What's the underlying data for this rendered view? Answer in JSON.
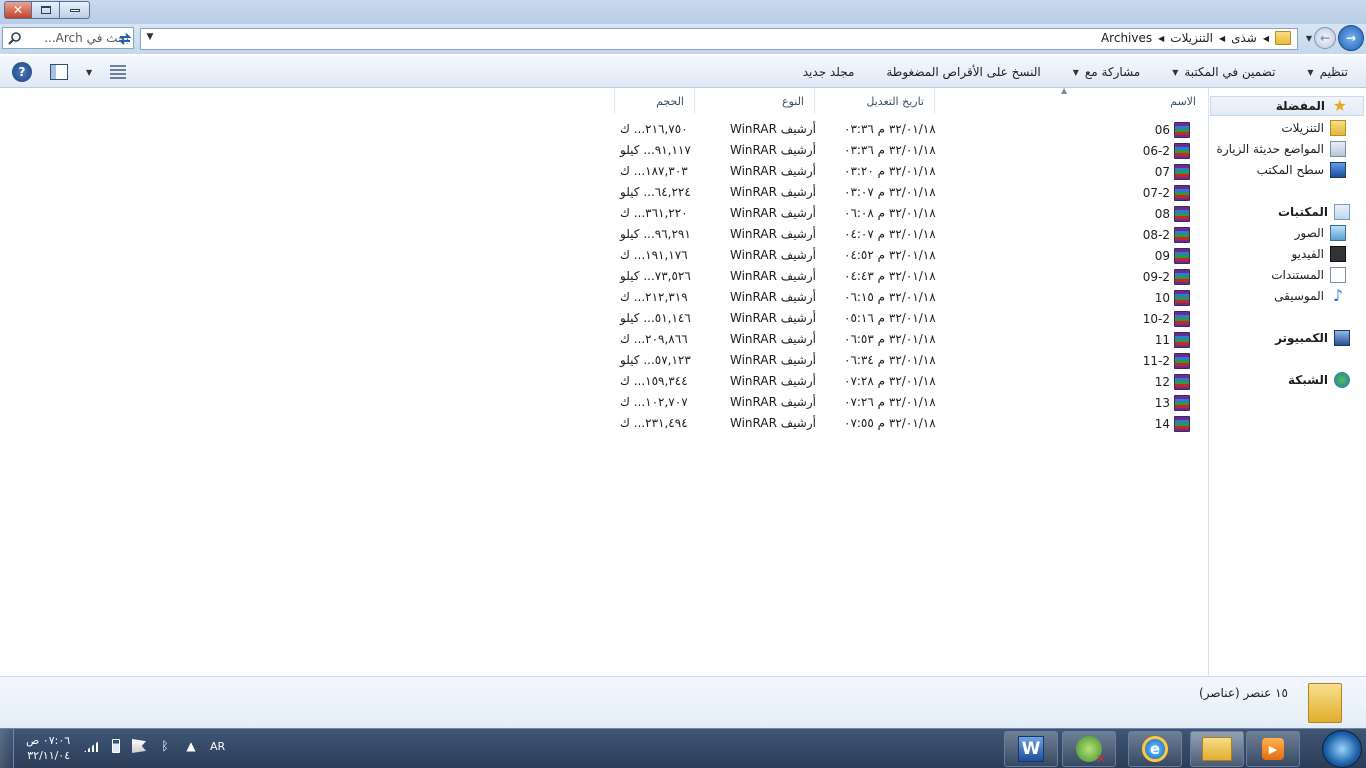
{
  "window": {
    "close_label": "✕"
  },
  "address": {
    "search_placeholder": "بحث في Arch...",
    "breadcrumbs": [
      "شذى",
      "التنزيلات",
      "Archives"
    ]
  },
  "commands": {
    "organize": "تنظيم",
    "include_in_library": "تضمين في المكتبة",
    "share_with": "مشاركة مع",
    "burn": "النسخ على الأقراص المضغوطة",
    "new_folder": "مجلد جديد",
    "help_label": "?"
  },
  "nav": {
    "favorites": "المفضلة",
    "downloads": "التنزيلات",
    "recent_places": "المواضع حديثة الزيارة",
    "desktop": "سطح المكتب",
    "libraries": "المكتبات",
    "pictures": "الصور",
    "videos": "الفيديو",
    "documents": "المستندات",
    "music": "الموسيقى",
    "computer": "الكمبيوتر",
    "network": "الشبكة"
  },
  "columns": {
    "name": "الاسم",
    "date_modified": "تاريخ التعديل",
    "type": "النوع",
    "size": "الحجم"
  },
  "files": [
    {
      "name": "06",
      "date": "٣٢/٠١/١٨ م ٠٣:٣٦",
      "type": "أرشيف WinRAR",
      "size": "٢١٦,٧٥٠... ك"
    },
    {
      "name": "06-2",
      "date": "٣٢/٠١/١٨ م ٠٣:٣٦",
      "type": "أرشيف WinRAR",
      "size": "٩١,١١٧... كيلو"
    },
    {
      "name": "07",
      "date": "٣٢/٠١/١٨ م ٠٣:٢٠",
      "type": "أرشيف WinRAR",
      "size": "١٨٧,٣٠٣... ك"
    },
    {
      "name": "07-2",
      "date": "٣٢/٠١/١٨ م ٠٣:٠٧",
      "type": "أرشيف WinRAR",
      "size": "٦٤,٢٢٤... كيلو"
    },
    {
      "name": "08",
      "date": "٣٢/٠١/١٨ م ٠٦:٠٨",
      "type": "أرشيف WinRAR",
      "size": "٣٦١,٢٢٠... ك"
    },
    {
      "name": "08-2",
      "date": "٣٢/٠١/١٨ م ٠٤:٠٧",
      "type": "أرشيف WinRAR",
      "size": "٩٦,٢٩١... كيلو"
    },
    {
      "name": "09",
      "date": "٣٢/٠١/١٨ م ٠٤:٥٢",
      "type": "أرشيف WinRAR",
      "size": "١٩١,١٧٦... ك"
    },
    {
      "name": "09-2",
      "date": "٣٢/٠١/١٨ م ٠٤:٤٣",
      "type": "أرشيف WinRAR",
      "size": "٧٣,٥٢٦... كيلو"
    },
    {
      "name": "10",
      "date": "٣٢/٠١/١٨ م ٠٦:١٥",
      "type": "أرشيف WinRAR",
      "size": "٢١٢,٣١٩... ك"
    },
    {
      "name": "10-2",
      "date": "٣٢/٠١/١٨ م ٠٥:١٦",
      "type": "أرشيف WinRAR",
      "size": "٥١,١٤٦... كيلو"
    },
    {
      "name": "11",
      "date": "٣٢/٠١/١٨ م ٠٦:٥٣",
      "type": "أرشيف WinRAR",
      "size": "٢٠٩,٨٦٦... ك"
    },
    {
      "name": "11-2",
      "date": "٣٢/٠١/١٨ م ٠٦:٣٤",
      "type": "أرشيف WinRAR",
      "size": "٥٧,١٢٣... كيلو"
    },
    {
      "name": "12",
      "date": "٣٢/٠١/١٨ م ٠٧:٢٨",
      "type": "أرشيف WinRAR",
      "size": "١٥٩,٣٤٤... ك"
    },
    {
      "name": "13",
      "date": "٣٢/٠١/١٨ م ٠٧:٢٦",
      "type": "أرشيف WinRAR",
      "size": "١٠٢,٧٠٧... ك"
    },
    {
      "name": "14",
      "date": "٣٢/٠١/١٨ م ٠٧:٥٥",
      "type": "أرشيف WinRAR",
      "size": "٢٣١,٤٩٤... ك"
    }
  ],
  "status": {
    "item_count": "١٥ عنصر (عناصر)"
  },
  "taskbar": {
    "word_label": "W",
    "ie_label": "e",
    "media_label": "▶",
    "language": "AR",
    "time": "٠٧:٠٦ ص",
    "date": "٣٢/١١/٠٤"
  }
}
